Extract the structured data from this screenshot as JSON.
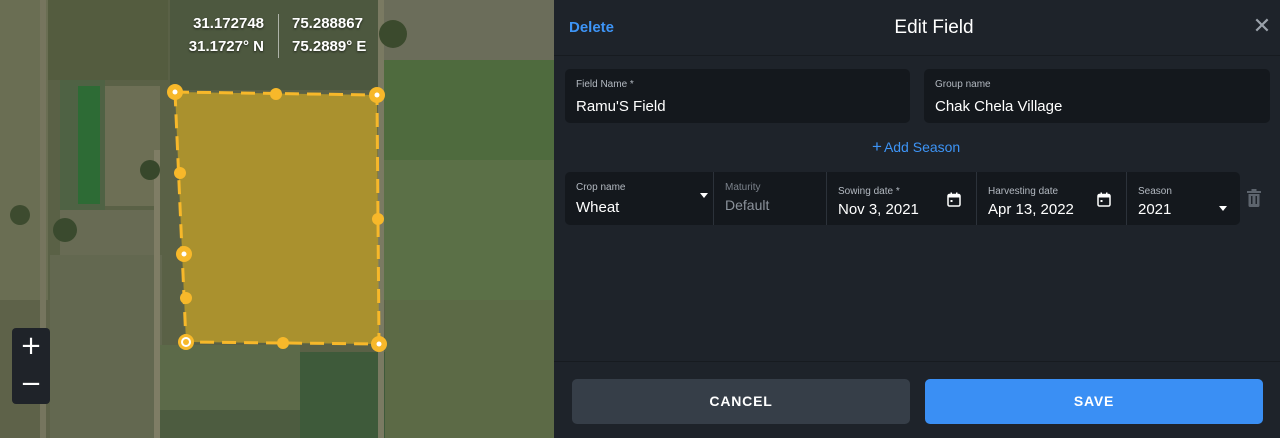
{
  "map": {
    "coords": {
      "lat_decimal": "31.172748",
      "lat_dms": "31.1727° N",
      "lng_decimal": "75.288867",
      "lng_dms": "75.2889° E"
    },
    "zoom_in_label": "+",
    "zoom_out_label": "−",
    "polygon_color": "#f7b82a"
  },
  "panel": {
    "delete_label": "Delete",
    "title": "Edit Field",
    "close_icon": "close-icon",
    "field_name": {
      "label": "Field Name *",
      "value": "Ramu'S Field"
    },
    "group_name": {
      "label": "Group name",
      "value": "Chak Chela Village"
    },
    "add_season_label": "Add Season",
    "add_season_plus": "+",
    "season": {
      "crop": {
        "label": "Crop name",
        "value": "Wheat"
      },
      "maturity": {
        "label": "Maturity",
        "value": "Default"
      },
      "sowing": {
        "label": "Sowing date *",
        "value": "Nov 3, 2021"
      },
      "harvesting": {
        "label": "Harvesting date",
        "value": "Apr 13, 2022"
      },
      "season": {
        "label": "Season",
        "value": "2021"
      }
    },
    "cancel_label": "CANCEL",
    "save_label": "SAVE"
  },
  "colors": {
    "accent": "#3a8ff4",
    "panel_bg": "#1e232a",
    "input_bg": "#14181d"
  }
}
